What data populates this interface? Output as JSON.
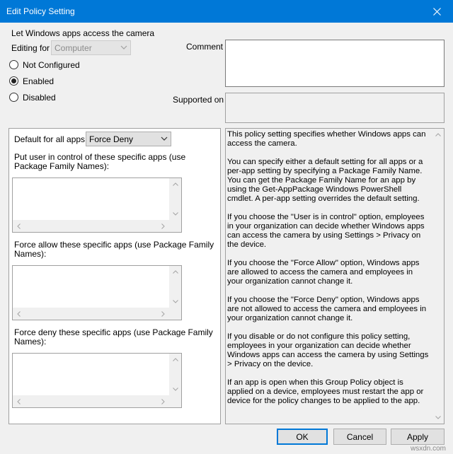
{
  "window": {
    "title": "Edit Policy Setting",
    "close_glyph": "✕"
  },
  "policy": {
    "name": "Let Windows apps access the camera",
    "editing_for_label": "Editing for",
    "editing_for_value": "Computer"
  },
  "state": {
    "options": [
      "Not Configured",
      "Enabled",
      "Disabled"
    ],
    "selected": "Enabled"
  },
  "comment_label": "Comment",
  "supported_on_label": "Supported on",
  "options_panel": {
    "default_label": "Default for all apps:",
    "default_value": "Force Deny",
    "user_control_label": "Put user in control of these specific apps (use Package Family Names):",
    "force_allow_label": "Force allow these specific apps (use Package Family Names):",
    "force_deny_label": "Force deny these specific apps (use Package Family Names):"
  },
  "help": {
    "paragraphs": [
      "This policy setting specifies whether Windows apps can access the camera.",
      "You can specify either a default setting for all apps or a per-app setting by specifying a Package Family Name. You can get the Package Family Name for an app by using the Get-AppPackage Windows PowerShell cmdlet. A per-app setting overrides the default setting.",
      "If you choose the \"User is in control\" option, employees in your organization can decide whether Windows apps can access the camera by using Settings > Privacy on the device.",
      "If you choose the \"Force Allow\" option, Windows apps are allowed to access the camera and employees in your organization cannot change it.",
      "If you choose the \"Force Deny\" option, Windows apps are not allowed to access the camera and employees in your organization cannot change it.",
      "If you disable or do not configure this policy setting, employees in your organization can decide whether Windows apps can access the camera by using Settings > Privacy on the device.",
      "If an app is open when this Group Policy object is applied on a device, employees must restart the app or device for the policy changes to be applied to the app."
    ]
  },
  "buttons": {
    "ok": "OK",
    "cancel": "Cancel",
    "apply": "Apply"
  },
  "watermark": "wsxdn.com",
  "colors": {
    "titlebar": "#0078d7",
    "dialog_bg": "#f0f0f0"
  }
}
